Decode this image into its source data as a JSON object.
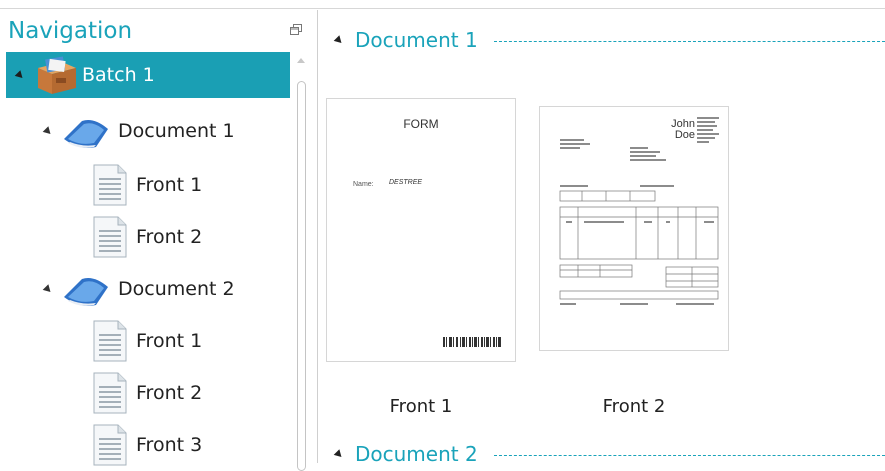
{
  "navigation": {
    "title": "Navigation",
    "tree": [
      {
        "label": "Batch 1",
        "icon": "batch-box-icon"
      },
      {
        "label": "Document 1",
        "icon": "document-book-icon"
      },
      {
        "label": "Front 1",
        "icon": "page-icon"
      },
      {
        "label": "Front 2",
        "icon": "page-icon"
      },
      {
        "label": "Document 2",
        "icon": "document-book-icon"
      },
      {
        "label": "Front 1",
        "icon": "page-icon"
      },
      {
        "label": "Front 2",
        "icon": "page-icon"
      },
      {
        "label": "Front 3",
        "icon": "page-icon"
      }
    ]
  },
  "content": {
    "documents": [
      {
        "title": "Document 1",
        "pages": [
          {
            "caption": "Front 1",
            "form_title": "FORM",
            "form_field_label": "Name:",
            "form_field_value": "DESTREE"
          },
          {
            "caption": "Front 2",
            "invoice_name": "John Doe"
          }
        ]
      },
      {
        "title": "Document 2"
      }
    ]
  },
  "colors": {
    "accent": "#1aa3ba",
    "selected_bg": "#1a9fb4"
  }
}
